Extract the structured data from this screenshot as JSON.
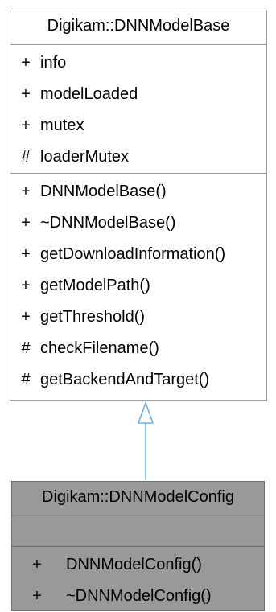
{
  "base_class": {
    "name": "Digikam::DNNModelBase",
    "attributes": [
      {
        "visibility": "+",
        "name": "info"
      },
      {
        "visibility": "+",
        "name": "modelLoaded"
      },
      {
        "visibility": "+",
        "name": "mutex"
      },
      {
        "visibility": "#",
        "name": "loaderMutex"
      }
    ],
    "operations": [
      {
        "visibility": "+",
        "name": "DNNModelBase()"
      },
      {
        "visibility": "+",
        "name": "~DNNModelBase()"
      },
      {
        "visibility": "+",
        "name": "getDownloadInformation()"
      },
      {
        "visibility": "+",
        "name": "getModelPath()"
      },
      {
        "visibility": "+",
        "name": "getThreshold()"
      },
      {
        "visibility": "#",
        "name": "checkFilename()"
      },
      {
        "visibility": "#",
        "name": "getBackendAndTarget()"
      }
    ]
  },
  "derived_class": {
    "name": "Digikam::DNNModelConfig",
    "attributes": [],
    "operations": [
      {
        "visibility": "+",
        "name": "DNNModelConfig()"
      },
      {
        "visibility": "+",
        "name": "~DNNModelConfig()"
      }
    ]
  },
  "colors": {
    "base_fill": "#ffffff",
    "derived_fill": "#999999",
    "inheritance_arrow": "#6fb0e0"
  }
}
